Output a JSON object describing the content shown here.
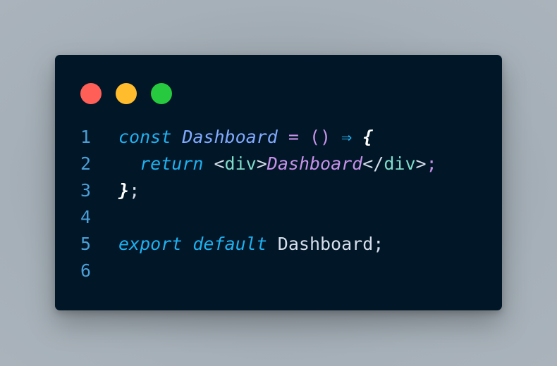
{
  "window": {
    "controls": [
      {
        "name": "close-button",
        "color": "#ff5f56"
      },
      {
        "name": "minimize-button",
        "color": "#ffbd2e"
      },
      {
        "name": "maximize-button",
        "color": "#27c93f"
      }
    ]
  },
  "code": {
    "lines": [
      {
        "number": "1",
        "tokens": [
          "const",
          " ",
          "Dashboard",
          " ",
          "=",
          " ",
          "()",
          " ",
          "⇒",
          " ",
          "{"
        ]
      },
      {
        "number": "2",
        "tokens": [
          "  ",
          "return",
          " ",
          "<",
          "div",
          ">",
          "Dashboard",
          "</",
          "div",
          ">",
          ";"
        ]
      },
      {
        "number": "3",
        "tokens": [
          "}",
          ";"
        ]
      },
      {
        "number": "4",
        "tokens": []
      },
      {
        "number": "5",
        "tokens": [
          "export",
          " ",
          "default",
          " ",
          "Dashboard",
          ";"
        ]
      },
      {
        "number": "6",
        "tokens": []
      }
    ]
  }
}
